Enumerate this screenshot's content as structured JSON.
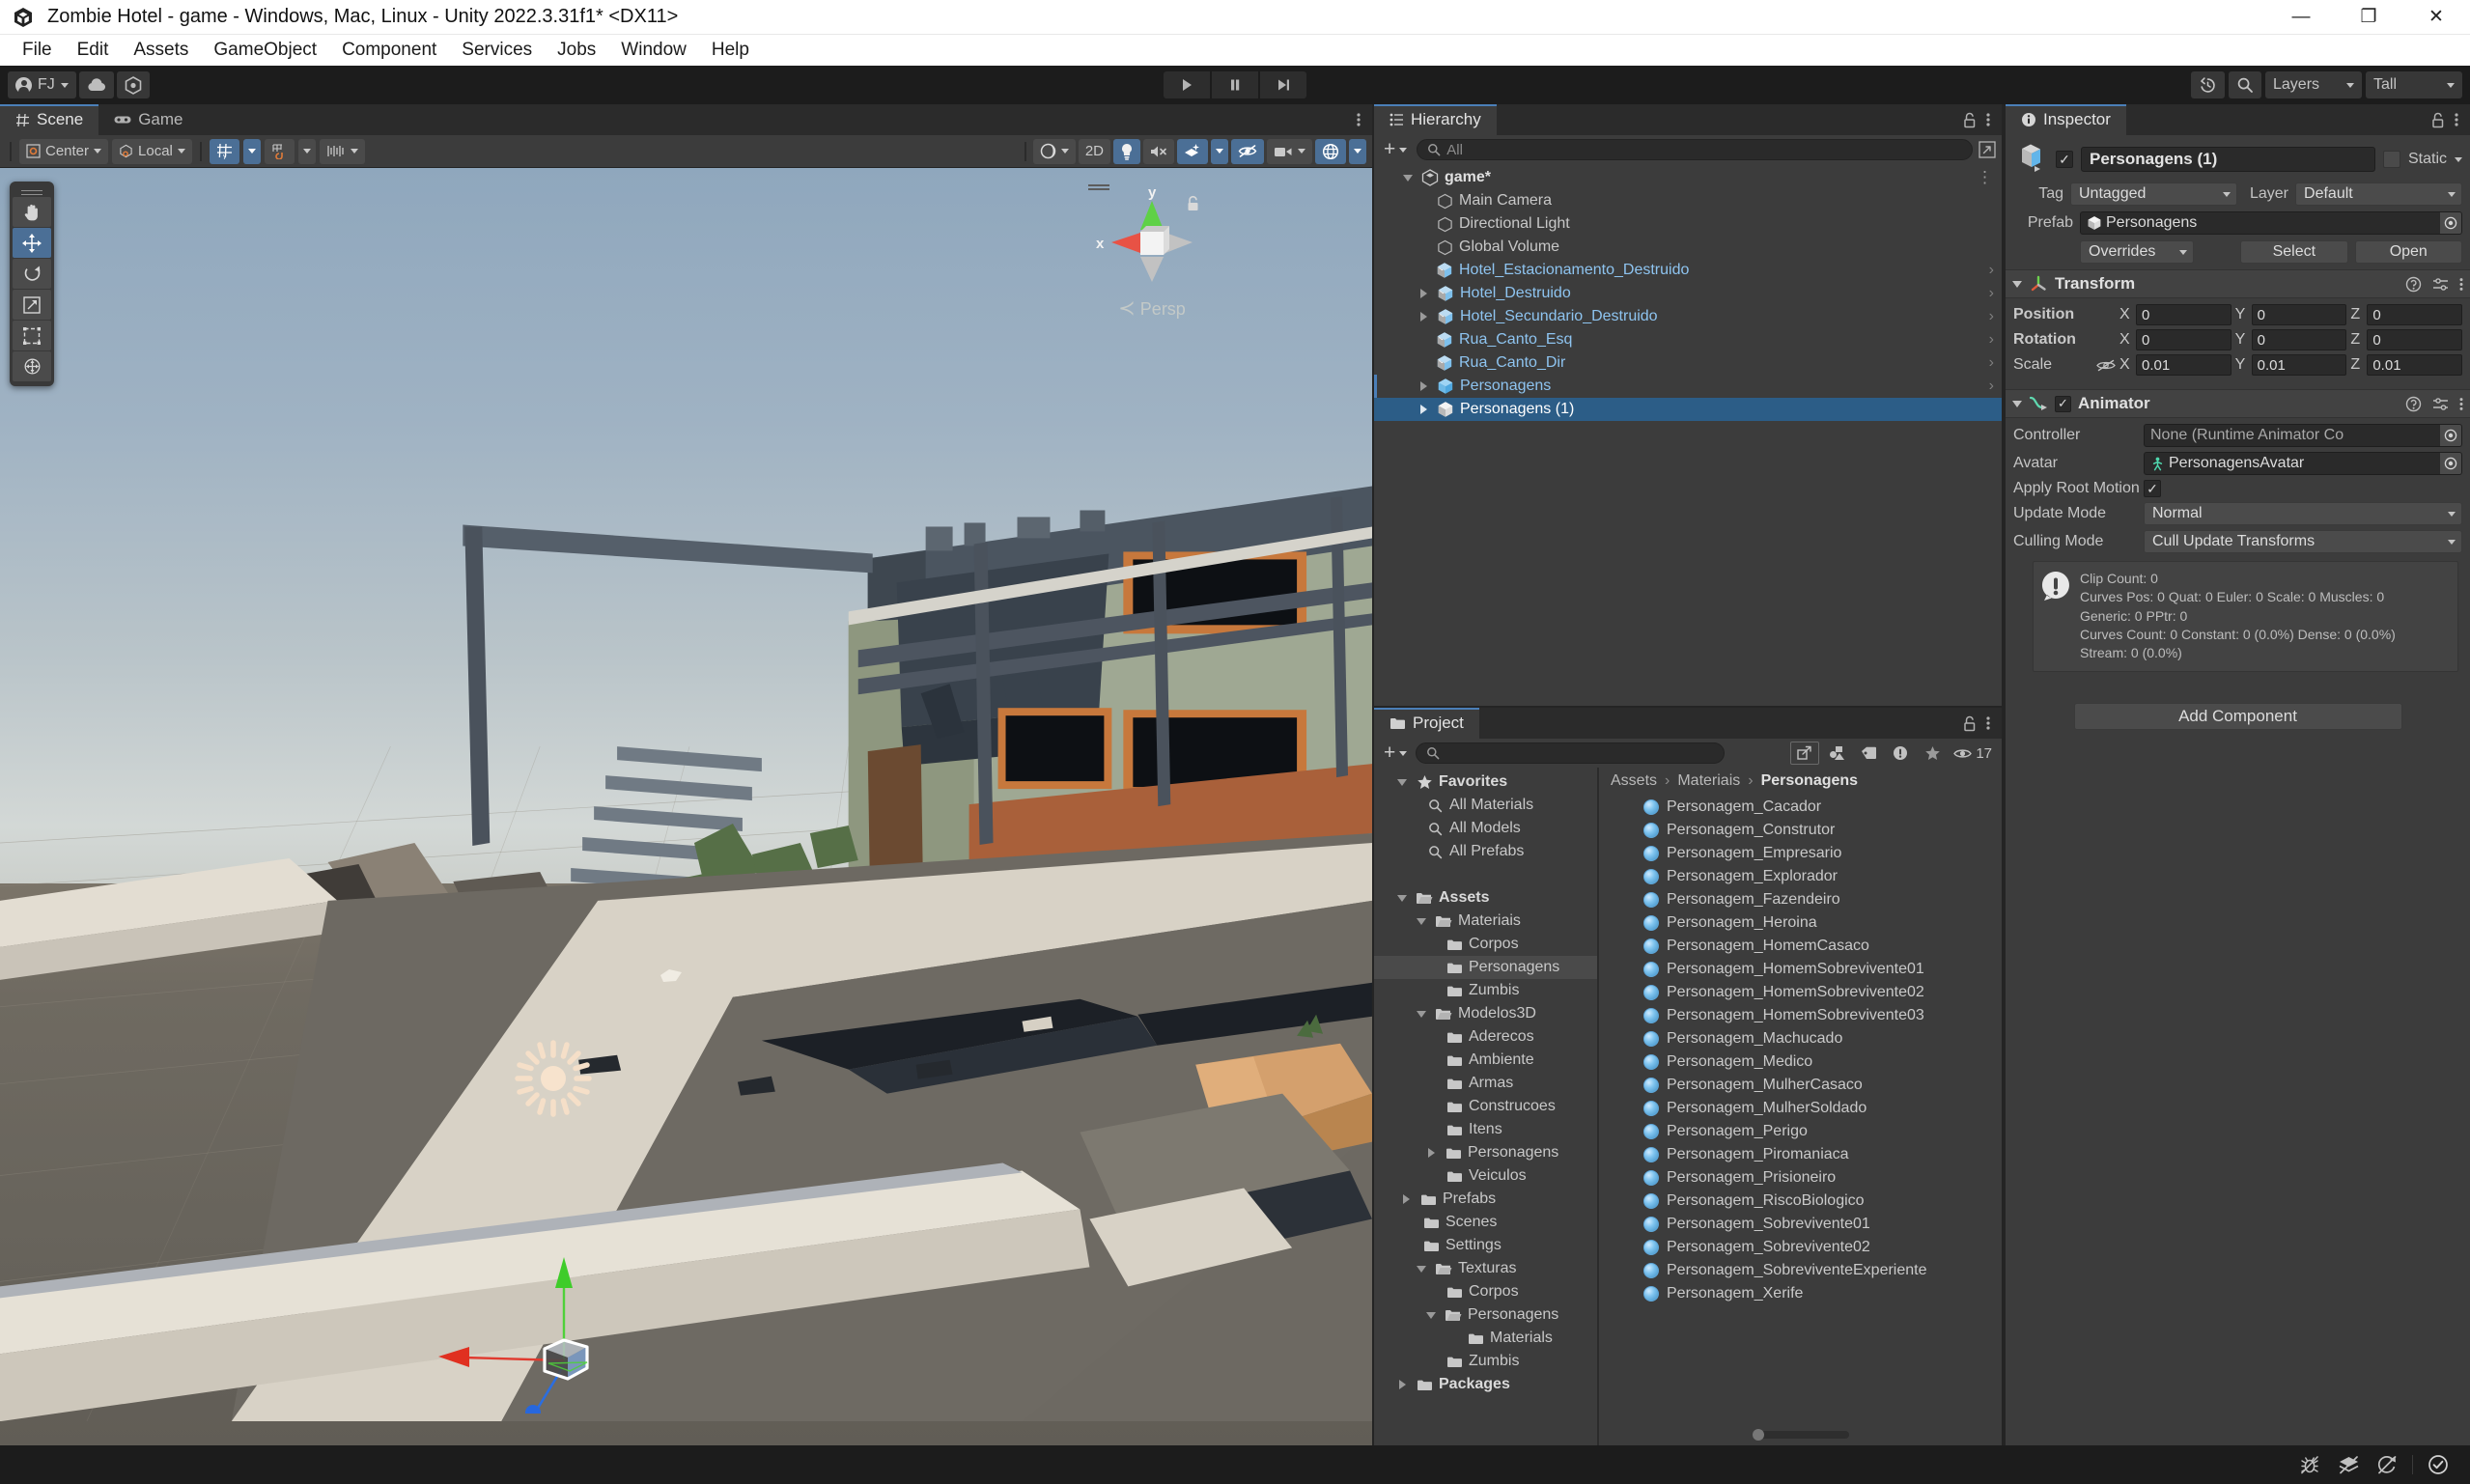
{
  "window": {
    "title": "Zombie Hotel - game - Windows, Mac, Linux - Unity 2022.3.31f1* <DX11>",
    "app_icon": "unity-logo-icon",
    "minimize": "—",
    "maximize": "❐",
    "close": "✕"
  },
  "menubar": {
    "items": [
      "File",
      "Edit",
      "Assets",
      "GameObject",
      "Component",
      "Services",
      "Jobs",
      "Window",
      "Help"
    ]
  },
  "toolbar": {
    "account_label": "FJ",
    "cloud_icon": "cloud-icon",
    "collab_icon": "unity-services-icon",
    "play_icon": "play-icon",
    "pause_icon": "pause-icon",
    "step_icon": "step-icon",
    "history_icon": "undo-history-icon",
    "search_icon": "search-icon",
    "layers_label": "Layers",
    "layout_label": "Tall"
  },
  "scene": {
    "tabs": [
      {
        "label": "Scene",
        "icon": "scene-grid-icon",
        "active": true
      },
      {
        "label": "Game",
        "icon": "gamepad-icon",
        "active": false
      }
    ],
    "pivot_mode": "Center",
    "pivot_rotation": "Local",
    "grid_snap_icon": "grid-snap-icon",
    "surface_snap_icon": "surface-snap-icon",
    "increment_snap_icon": "increment-snap-icon",
    "shading_mode_icon": "shaded-sphere-icon",
    "toggle_2d": "2D",
    "lighting_icon": "lightbulb-icon",
    "audio_icon": "audio-mute-icon",
    "effects_icon": "fx-icon",
    "hidden_icon": "eye-slash-icon",
    "camera_icon": "camera-icon",
    "gizmos_icon": "gizmos-globe-icon",
    "tools": [
      {
        "name": "hand-tool",
        "icon": "hand-icon",
        "active": false
      },
      {
        "name": "move-tool",
        "icon": "move-arrows-icon",
        "active": true
      },
      {
        "name": "rotate-tool",
        "icon": "rotate-icon",
        "active": false
      },
      {
        "name": "scale-tool",
        "icon": "scale-icon",
        "active": false
      },
      {
        "name": "rect-tool",
        "icon": "rect-transform-icon",
        "active": false
      },
      {
        "name": "transform-tool",
        "icon": "transform-icon",
        "active": false
      }
    ],
    "gizmo": {
      "x_axis": "x",
      "y_axis": "y",
      "projection": "Persp",
      "lock_icon": "padlock-icon"
    }
  },
  "hierarchy": {
    "tab_label": "Hierarchy",
    "tab_icon": "hierarchy-icon",
    "lock_icon": "padlock-icon",
    "menu_icon": "kebab-menu-icon",
    "add_label": "+",
    "search_placeholder": "All",
    "search_icon": "search-icon",
    "items": [
      {
        "label": "game*",
        "depth": 0,
        "icon": "unity-scene-icon",
        "expanded": true,
        "type": "scene",
        "selected": false,
        "has_menu": true
      },
      {
        "label": "Main Camera",
        "depth": 1,
        "icon": "gameobject-cube-icon",
        "expanded": null,
        "type": "gameobject",
        "selected": false
      },
      {
        "label": "Directional Light",
        "depth": 1,
        "icon": "gameobject-cube-icon",
        "expanded": null,
        "type": "gameobject",
        "selected": false
      },
      {
        "label": "Global Volume",
        "depth": 1,
        "icon": "gameobject-cube-icon",
        "expanded": null,
        "type": "gameobject",
        "selected": false
      },
      {
        "label": "Hotel_Estacionamento_Destruido",
        "depth": 1,
        "icon": "prefab-model-icon",
        "expanded": null,
        "type": "prefab",
        "selected": false,
        "chevron": true
      },
      {
        "label": "Hotel_Destruido",
        "depth": 1,
        "icon": "prefab-model-icon",
        "expanded": false,
        "type": "prefab",
        "selected": false,
        "chevron": true
      },
      {
        "label": "Hotel_Secundario_Destruido",
        "depth": 1,
        "icon": "prefab-model-icon",
        "expanded": false,
        "type": "prefab",
        "selected": false,
        "chevron": true
      },
      {
        "label": "Rua_Canto_Esq",
        "depth": 1,
        "icon": "prefab-model-icon",
        "expanded": null,
        "type": "prefab",
        "selected": false,
        "chevron": true
      },
      {
        "label": "Rua_Canto_Dir",
        "depth": 1,
        "icon": "prefab-model-icon",
        "expanded": null,
        "type": "prefab",
        "selected": false,
        "chevron": true
      },
      {
        "label": "Personagens",
        "depth": 1,
        "icon": "prefab-blue-icon",
        "expanded": false,
        "type": "prefab",
        "selected": false,
        "chevron": true,
        "marker": true
      },
      {
        "label": "Personagens (1)",
        "depth": 1,
        "icon": "prefab-white-icon",
        "expanded": false,
        "type": "prefab",
        "selected": true,
        "chevron": false
      }
    ]
  },
  "project": {
    "tab_label": "Project",
    "tab_icon": "folder-icon",
    "lock_icon": "padlock-icon",
    "menu_icon": "kebab-menu-icon",
    "add_label": "+",
    "search_icon": "search-icon",
    "search_value": "",
    "filter_icons": [
      "open-in-new-icon",
      "type-filter-icon",
      "label-filter-icon",
      "warning-filter-icon",
      "favorite-star-icon"
    ],
    "eye_icon": "eye-icon",
    "eye_count": "17",
    "tree": [
      {
        "label": "Favorites",
        "depth": 0,
        "icon": "star-icon",
        "expanded": true,
        "bold": true
      },
      {
        "label": "All Materials",
        "depth": 1,
        "icon": "search-icon",
        "expanded": null
      },
      {
        "label": "All Models",
        "depth": 1,
        "icon": "search-icon",
        "expanded": null
      },
      {
        "label": "All Prefabs",
        "depth": 1,
        "icon": "search-icon",
        "expanded": null
      },
      {
        "label": "",
        "depth": 0,
        "icon": "spacer",
        "expanded": null
      },
      {
        "label": "Assets",
        "depth": 0,
        "icon": "folder-open-icon",
        "expanded": true,
        "bold": true
      },
      {
        "label": "Materiais",
        "depth": 1,
        "icon": "folder-open-icon",
        "expanded": true
      },
      {
        "label": "Corpos",
        "depth": 2,
        "icon": "folder-icon",
        "expanded": null
      },
      {
        "label": "Personagens",
        "depth": 2,
        "icon": "folder-icon",
        "expanded": null,
        "selected": true
      },
      {
        "label": "Zumbis",
        "depth": 2,
        "icon": "folder-icon",
        "expanded": null
      },
      {
        "label": "Modelos3D",
        "depth": 1,
        "icon": "folder-open-icon",
        "expanded": true
      },
      {
        "label": "Aderecos",
        "depth": 2,
        "icon": "folder-icon",
        "expanded": null
      },
      {
        "label": "Ambiente",
        "depth": 2,
        "icon": "folder-icon",
        "expanded": null
      },
      {
        "label": "Armas",
        "depth": 2,
        "icon": "folder-icon",
        "expanded": null
      },
      {
        "label": "Construcoes",
        "depth": 2,
        "icon": "folder-icon",
        "expanded": null
      },
      {
        "label": "Itens",
        "depth": 2,
        "icon": "folder-icon",
        "expanded": null
      },
      {
        "label": "Personagens",
        "depth": 2,
        "icon": "folder-icon",
        "expanded": false
      },
      {
        "label": "Veiculos",
        "depth": 2,
        "icon": "folder-icon",
        "expanded": null
      },
      {
        "label": "Prefabs",
        "depth": 1,
        "icon": "folder-icon",
        "expanded": false
      },
      {
        "label": "Scenes",
        "depth": 1,
        "icon": "folder-icon",
        "expanded": null
      },
      {
        "label": "Settings",
        "depth": 1,
        "icon": "folder-icon",
        "expanded": null
      },
      {
        "label": "Texturas",
        "depth": 1,
        "icon": "folder-open-icon",
        "expanded": true
      },
      {
        "label": "Corpos",
        "depth": 2,
        "icon": "folder-icon",
        "expanded": null
      },
      {
        "label": "Personagens",
        "depth": 2,
        "icon": "folder-open-icon",
        "expanded": true
      },
      {
        "label": "Materials",
        "depth": 3,
        "icon": "folder-icon",
        "expanded": null
      },
      {
        "label": "Zumbis",
        "depth": 2,
        "icon": "folder-icon",
        "expanded": null
      },
      {
        "label": "Packages",
        "depth": 0,
        "icon": "folder-icon",
        "expanded": false,
        "bold": true
      }
    ],
    "breadcrumb": [
      "Assets",
      "Materiais",
      "Personagens"
    ],
    "assets": [
      {
        "label": "Personagem_Cacador",
        "icon": "material-ball-icon"
      },
      {
        "label": "Personagem_Construtor",
        "icon": "material-ball-icon"
      },
      {
        "label": "Personagem_Empresario",
        "icon": "material-ball-icon"
      },
      {
        "label": "Personagem_Explorador",
        "icon": "material-ball-icon"
      },
      {
        "label": "Personagem_Fazendeiro",
        "icon": "material-ball-icon"
      },
      {
        "label": "Personagem_Heroina",
        "icon": "material-ball-icon"
      },
      {
        "label": "Personagem_HomemCasaco",
        "icon": "material-ball-icon"
      },
      {
        "label": "Personagem_HomemSobrevivente01",
        "icon": "material-ball-icon"
      },
      {
        "label": "Personagem_HomemSobrevivente02",
        "icon": "material-ball-icon"
      },
      {
        "label": "Personagem_HomemSobrevivente03",
        "icon": "material-ball-icon"
      },
      {
        "label": "Personagem_Machucado",
        "icon": "material-ball-icon"
      },
      {
        "label": "Personagem_Medico",
        "icon": "material-ball-icon"
      },
      {
        "label": "Personagem_MulherCasaco",
        "icon": "material-ball-icon"
      },
      {
        "label": "Personagem_MulherSoldado",
        "icon": "material-ball-icon"
      },
      {
        "label": "Personagem_Perigo",
        "icon": "material-ball-icon"
      },
      {
        "label": "Personagem_Piromaniaca",
        "icon": "material-ball-icon"
      },
      {
        "label": "Personagem_Prisioneiro",
        "icon": "material-ball-icon"
      },
      {
        "label": "Personagem_RiscoBiologico",
        "icon": "material-ball-icon"
      },
      {
        "label": "Personagem_Sobrevivente01",
        "icon": "material-ball-icon"
      },
      {
        "label": "Personagem_Sobrevivente02",
        "icon": "material-ball-icon"
      },
      {
        "label": "Personagem_SobreviventeExperiente",
        "icon": "material-ball-icon"
      },
      {
        "label": "Personagem_Xerife",
        "icon": "material-ball-icon"
      }
    ]
  },
  "inspector": {
    "tab_label": "Inspector",
    "tab_icon": "info-circle-icon",
    "lock_icon": "padlock-icon",
    "menu_icon": "kebab-menu-icon",
    "object_name": "Personagens (1)",
    "enabled": true,
    "static_label": "Static",
    "static_checked": false,
    "tag_label": "Tag",
    "tag_value": "Untagged",
    "layer_label": "Layer",
    "layer_value": "Default",
    "prefab_label": "Prefab",
    "prefab_value": "Personagens",
    "overrides_label": "Overrides",
    "select_label": "Select",
    "open_label": "Open",
    "transform": {
      "title": "Transform",
      "icon": "transform-axis-icon",
      "rows": [
        {
          "label": "Position",
          "x": "0",
          "y": "0",
          "z": "0"
        },
        {
          "label": "Rotation",
          "x": "0",
          "y": "0",
          "z": "0"
        },
        {
          "label": "Scale",
          "x": "0.01",
          "y": "0.01",
          "z": "0.01",
          "link_icon": "constrain-proportions-off-icon"
        }
      ]
    },
    "animator": {
      "title": "Animator",
      "icon": "animator-icon",
      "enabled": true,
      "controller_label": "Controller",
      "controller_value": "None (Runtime Animator Co",
      "avatar_label": "Avatar",
      "avatar_value": "PersonagensAvatar",
      "avatar_icon": "avatar-icon",
      "apply_root_motion_label": "Apply Root Motion",
      "apply_root_motion_checked": true,
      "update_mode_label": "Update Mode",
      "update_mode_value": "Normal",
      "culling_mode_label": "Culling Mode",
      "culling_mode_value": "Cull Update Transforms",
      "info_icon": "warning-exclamation-icon",
      "info_lines": [
        "Clip Count: 0",
        "Curves Pos: 0 Quat: 0 Euler: 0 Scale: 0 Muscles: 0",
        "Generic: 0 PPtr: 0",
        "Curves Count: 0 Constant: 0 (0.0%) Dense: 0 (0.0%)",
        "Stream: 0 (0.0%)"
      ]
    },
    "add_component_label": "Add Component"
  },
  "statusbar": {
    "icons": [
      "bug-disabled-icon",
      "layers-disabled-icon",
      "refresh-disabled-icon",
      "check-circle-icon"
    ]
  },
  "colors": {
    "accent_blue": "#4b7fb8",
    "selection_blue": "#2c5d87",
    "prefab_blue": "#8ec4f0",
    "panel_bg": "#3c3c3c",
    "toolbar_bg": "#1c1c1c",
    "tab_bg": "#2b2b2b"
  }
}
